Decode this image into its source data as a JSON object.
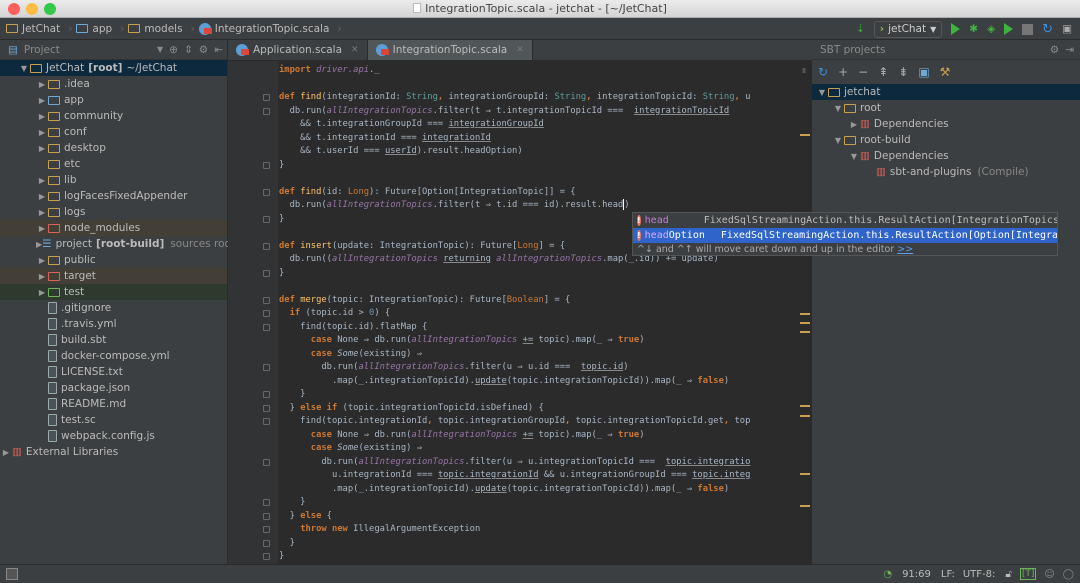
{
  "window": {
    "title": "IntegrationTopic.scala - jetchat - [~/JetChat]"
  },
  "breadcrumbs": [
    "JetChat",
    "app",
    "models",
    "IntegrationTopic.scala"
  ],
  "run_config": {
    "label": "jetChat"
  },
  "project_panel": {
    "title": "Project",
    "items": [
      {
        "label": "JetChat",
        "bold": "[root]",
        "extra": "~/JetChat",
        "depth": 0,
        "arrow": "open",
        "icon": "folder-module",
        "state": "selected"
      },
      {
        "label": ".idea",
        "depth": 1,
        "arrow": "closed",
        "icon": "folder"
      },
      {
        "label": "app",
        "depth": 1,
        "arrow": "closed",
        "icon": "folder-blue"
      },
      {
        "label": "community",
        "depth": 1,
        "arrow": "closed",
        "icon": "folder"
      },
      {
        "label": "conf",
        "depth": 1,
        "arrow": "closed",
        "icon": "folder"
      },
      {
        "label": "desktop",
        "depth": 1,
        "arrow": "closed",
        "icon": "folder"
      },
      {
        "label": "etc",
        "depth": 1,
        "arrow": "none",
        "icon": "folder"
      },
      {
        "label": "lib",
        "depth": 1,
        "arrow": "closed",
        "icon": "folder"
      },
      {
        "label": "logFacesFixedAppender",
        "depth": 1,
        "arrow": "closed",
        "icon": "folder"
      },
      {
        "label": "logs",
        "depth": 1,
        "arrow": "closed",
        "icon": "folder"
      },
      {
        "label": "node_modules",
        "depth": 1,
        "arrow": "closed",
        "icon": "folder-red",
        "state": "excluded"
      },
      {
        "label": "project",
        "bold": "[root-build]",
        "dim": "sources root",
        "depth": 1,
        "arrow": "closed",
        "icon": "source-root"
      },
      {
        "label": "public",
        "depth": 1,
        "arrow": "closed",
        "icon": "folder"
      },
      {
        "label": "target",
        "depth": 1,
        "arrow": "closed",
        "icon": "folder-red",
        "state": "excluded"
      },
      {
        "label": "test",
        "depth": 1,
        "arrow": "closed",
        "icon": "folder-green",
        "state": "test"
      },
      {
        "label": ".gitignore",
        "depth": 1,
        "arrow": "none",
        "icon": "file"
      },
      {
        "label": ".travis.yml",
        "depth": 1,
        "arrow": "none",
        "icon": "file"
      },
      {
        "label": "build.sbt",
        "depth": 1,
        "arrow": "none",
        "icon": "file"
      },
      {
        "label": "docker-compose.yml",
        "depth": 1,
        "arrow": "none",
        "icon": "file"
      },
      {
        "label": "LICENSE.txt",
        "depth": 1,
        "arrow": "none",
        "icon": "file"
      },
      {
        "label": "package.json",
        "depth": 1,
        "arrow": "none",
        "icon": "file"
      },
      {
        "label": "README.md",
        "depth": 1,
        "arrow": "none",
        "icon": "file"
      },
      {
        "label": "test.sc",
        "depth": 1,
        "arrow": "none",
        "icon": "file"
      },
      {
        "label": "webpack.config.js",
        "depth": 1,
        "arrow": "none",
        "icon": "file"
      },
      {
        "label": "External Libraries",
        "depth": -1,
        "arrow": "closed",
        "icon": "library"
      }
    ]
  },
  "tabs": [
    {
      "label": "Application.scala",
      "active": false
    },
    {
      "label": "IntegrationTopic.scala",
      "active": true
    }
  ],
  "editor": {
    "lines": [
      [
        [
          "k",
          "import "
        ],
        [
          "i",
          "driver.api"
        ],
        [
          "",
          "._"
        ]
      ],
      [],
      [
        [
          "k",
          "def "
        ],
        [
          "f",
          "find"
        ],
        [
          "",
          "(integrationId: "
        ],
        [
          "t",
          "String"
        ],
        [
          "k",
          ", "
        ],
        [
          "",
          "integrationGroupId: "
        ],
        [
          "t",
          "String"
        ],
        [
          "k",
          ", "
        ],
        [
          "",
          "integrationTopicId: "
        ],
        [
          "t",
          "String"
        ],
        [
          "k",
          ", "
        ],
        [
          "",
          "u"
        ]
      ],
      [
        [
          "",
          "  db.run("
        ],
        [
          "i",
          "allIntegrationTopics"
        ],
        [
          "",
          ".filter(t ⇒ t.integrationTopicId "
        ],
        [
          "op",
          "==="
        ],
        [
          "",
          "  "
        ],
        [
          "u",
          "integrationTopicId"
        ]
      ],
      [
        [
          "",
          "    && t.integrationGroupId "
        ],
        [
          "op",
          "==="
        ],
        [
          "",
          " "
        ],
        [
          "u",
          "integrationGroupId"
        ]
      ],
      [
        [
          "",
          "    && t.integrationId "
        ],
        [
          "op",
          "==="
        ],
        [
          "",
          " "
        ],
        [
          "u",
          "integrationId"
        ]
      ],
      [
        [
          "",
          "    && t.userId "
        ],
        [
          "op",
          "==="
        ],
        [
          "",
          " "
        ],
        [
          "u",
          "userId"
        ],
        [
          "",
          ").result.headOption)"
        ]
      ],
      [
        [
          "",
          "}"
        ]
      ],
      [],
      [
        [
          "k",
          "def "
        ],
        [
          "f",
          "find"
        ],
        [
          "",
          "(id: "
        ],
        [
          "t2",
          "Long"
        ],
        [
          "",
          "): Future[Option[IntegrationTopic]] = {"
        ]
      ],
      [
        [
          "",
          "  db.run("
        ],
        [
          "i",
          "allIntegrationTopics"
        ],
        [
          "",
          ".filter(t ⇒ t.id "
        ],
        [
          "op",
          "==="
        ],
        [
          "",
          " id).result.head"
        ],
        [
          "caret",
          ""
        ],
        [
          "",
          ")"
        ]
      ],
      [
        [
          "",
          "}"
        ]
      ],
      [],
      [
        [
          "k",
          "def "
        ],
        [
          "f",
          "insert"
        ],
        [
          "",
          "(update: IntegrationTopic): Future["
        ],
        [
          "t2",
          "Long"
        ],
        [
          "",
          "] = {"
        ]
      ],
      [
        [
          "",
          "  db.run(("
        ],
        [
          "i",
          "allIntegrationTopics"
        ],
        [
          "",
          " "
        ],
        [
          "u",
          "returning"
        ],
        [
          "",
          " "
        ],
        [
          "i",
          "allIntegrationTopics"
        ],
        [
          "",
          ".map(_.id)) += update)"
        ]
      ],
      [
        [
          "",
          "}"
        ]
      ],
      [],
      [
        [
          "k",
          "def "
        ],
        [
          "f",
          "merge"
        ],
        [
          "",
          "(topic: IntegrationTopic): Future["
        ],
        [
          "t2",
          "Boolean"
        ],
        [
          "",
          "] = {"
        ]
      ],
      [
        [
          "",
          "  "
        ],
        [
          "k",
          "if"
        ],
        [
          "",
          " (topic.id > "
        ],
        [
          "n",
          "0"
        ],
        [
          "",
          ") {"
        ]
      ],
      [
        [
          "",
          "    find(topic.id).flatMap {"
        ]
      ],
      [
        [
          "",
          "      "
        ],
        [
          "k",
          "case"
        ],
        [
          "",
          " None ⇒ db.run("
        ],
        [
          "i",
          "allIntegrationTopics"
        ],
        [
          "",
          " "
        ],
        [
          "u",
          "+="
        ],
        [
          "",
          " topic).map(_ ⇒ "
        ],
        [
          "k",
          "true"
        ],
        [
          "",
          ")"
        ]
      ],
      [
        [
          "",
          "      "
        ],
        [
          "k",
          "case"
        ],
        [
          "",
          " "
        ],
        [
          "it",
          "Some"
        ],
        [
          "",
          "(existing) ⇒"
        ]
      ],
      [
        [
          "",
          "        db.run("
        ],
        [
          "i",
          "allIntegrationTopics"
        ],
        [
          "",
          ".filter(u ⇒ u.id "
        ],
        [
          "op",
          "==="
        ],
        [
          "",
          "  "
        ],
        [
          "u",
          "topic.id"
        ],
        [
          "",
          ")"
        ]
      ],
      [
        [
          "",
          "          .map(_.integrationTopicId)."
        ],
        [
          "u",
          "update"
        ],
        [
          "",
          "(topic.integrationTopicId)).map(_ ⇒ "
        ],
        [
          "k",
          "false"
        ],
        [
          "",
          ")"
        ]
      ],
      [
        [
          "",
          "    }"
        ]
      ],
      [
        [
          "",
          "  } "
        ],
        [
          "k",
          "else if"
        ],
        [
          "",
          " (topic.integrationTopicId.isDefined) {"
        ]
      ],
      [
        [
          "",
          "    find(topic.integrationId"
        ],
        [
          "k",
          ", "
        ],
        [
          "",
          "topic.integrationGroupId"
        ],
        [
          "k",
          ", "
        ],
        [
          "",
          "topic.integrationTopicId.get"
        ],
        [
          "k",
          ", "
        ],
        [
          "",
          "top"
        ]
      ],
      [
        [
          "",
          "      "
        ],
        [
          "k",
          "case"
        ],
        [
          "",
          " None ⇒ db.run("
        ],
        [
          "i",
          "allIntegrationTopics"
        ],
        [
          "",
          " "
        ],
        [
          "u",
          "+="
        ],
        [
          "",
          " topic).map(_ ⇒ "
        ],
        [
          "k",
          "true"
        ],
        [
          "",
          ")"
        ]
      ],
      [
        [
          "",
          "      "
        ],
        [
          "k",
          "case"
        ],
        [
          "",
          " "
        ],
        [
          "it",
          "Some"
        ],
        [
          "",
          "(existing) ⇒"
        ]
      ],
      [
        [
          "",
          "        db.run("
        ],
        [
          "i",
          "allIntegrationTopics"
        ],
        [
          "",
          ".filter(u ⇒ u.integrationTopicId "
        ],
        [
          "op",
          "==="
        ],
        [
          "",
          "  "
        ],
        [
          "u",
          "topic.integratio"
        ]
      ],
      [
        [
          "",
          "          u.integrationId "
        ],
        [
          "op",
          "==="
        ],
        [
          "",
          " "
        ],
        [
          "u",
          "topic.integrationId"
        ],
        [
          "",
          " && u.integrationGroupId "
        ],
        [
          "op",
          "==="
        ],
        [
          "",
          " "
        ],
        [
          "u",
          "topic.integ"
        ]
      ],
      [
        [
          "",
          "          .map(_.integrationTopicId)."
        ],
        [
          "u",
          "update"
        ],
        [
          "",
          "(topic.integrationTopicId)).map(_ ⇒ "
        ],
        [
          "k",
          "false"
        ],
        [
          "",
          ")"
        ]
      ],
      [
        [
          "",
          "    }"
        ]
      ],
      [
        [
          "",
          "  } "
        ],
        [
          "k",
          "else"
        ],
        [
          "",
          " {"
        ]
      ],
      [
        [
          "",
          "    "
        ],
        [
          "k",
          "throw new"
        ],
        [
          "",
          " IllegalArgumentException"
        ]
      ],
      [
        [
          "",
          "  }"
        ]
      ],
      [
        [
          "",
          "}"
        ]
      ]
    ]
  },
  "completion": {
    "items": [
      {
        "match": "head",
        "rest": "",
        "type": "FixedSqlStreamingAction.this.ResultAction[IntegrationTopics…",
        "selected": false
      },
      {
        "match": "head",
        "rest": "Option",
        "type": "FixedSqlStreamingAction.this.ResultAction[Option[Integra",
        "selected": true
      }
    ],
    "hint": "^↓ and ^↑ will move caret down and up in the editor",
    "hint_link": ">>"
  },
  "sbt_panel": {
    "title": "SBT projects",
    "items": [
      {
        "label": "jetchat",
        "depth": 0,
        "arrow": "open",
        "icon": "folder-module",
        "state": "selected"
      },
      {
        "label": "root",
        "depth": 1,
        "arrow": "open",
        "icon": "folder-module"
      },
      {
        "label": "Dependencies",
        "depth": 2,
        "arrow": "closed",
        "icon": "dependencies"
      },
      {
        "label": "root-build",
        "depth": 1,
        "arrow": "open",
        "icon": "folder-module"
      },
      {
        "label": "Dependencies",
        "depth": 2,
        "arrow": "open",
        "icon": "dependencies"
      },
      {
        "label": "sbt-and-plugins",
        "dim": "(Compile)",
        "depth": 3,
        "arrow": "none",
        "icon": "library"
      }
    ]
  },
  "status": {
    "position": "91:69",
    "line_sep": "LF:",
    "encoding": "UTF-8:",
    "indicator": "[T]"
  },
  "colors": {
    "editor_bg": "#2b2b2b",
    "panel_bg": "#3c3f41",
    "keyword": "#cc7832",
    "selection": "#2f65ca",
    "run_green": "#3fb33f"
  }
}
